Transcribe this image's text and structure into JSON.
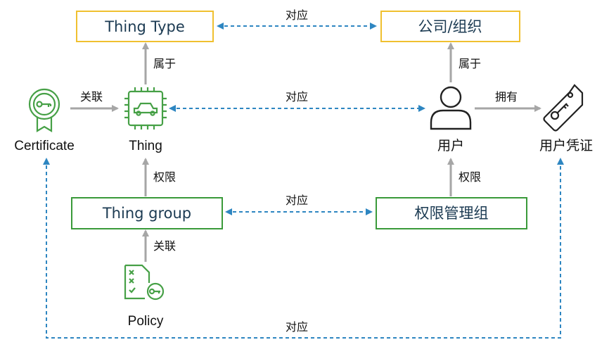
{
  "boxes": {
    "thing_type": "Thing Type",
    "company_org": "公司/组织",
    "thing_group": "Thing group",
    "permission_group": "权限管理组"
  },
  "nodes": {
    "certificate": "Certificate",
    "thing": "Thing",
    "user": "用户",
    "user_credential": "用户凭证",
    "policy": "Policy"
  },
  "edges": {
    "belongs_to_left": "属于",
    "belongs_to_right": "属于",
    "associate_cert": "关联",
    "associate_policy": "关联",
    "permission_left": "权限",
    "permission_right": "权限",
    "owns": "拥有",
    "correspond_top": "对应",
    "correspond_middle": "对应",
    "correspond_group": "对应",
    "correspond_bottom": "对应"
  },
  "icons": {
    "certificate": "certificate-icon",
    "thing": "chip-car-icon",
    "user": "user-icon",
    "credential": "tag-key-icon",
    "policy": "policy-icon"
  },
  "colors": {
    "yellow_border": "#f0c030",
    "green_border": "#3a9a3a",
    "green_icon": "#46a046",
    "gray_arrow": "#a6a6a6",
    "blue_dashed": "#2e86c1",
    "dark_text": "#1b3a52"
  }
}
